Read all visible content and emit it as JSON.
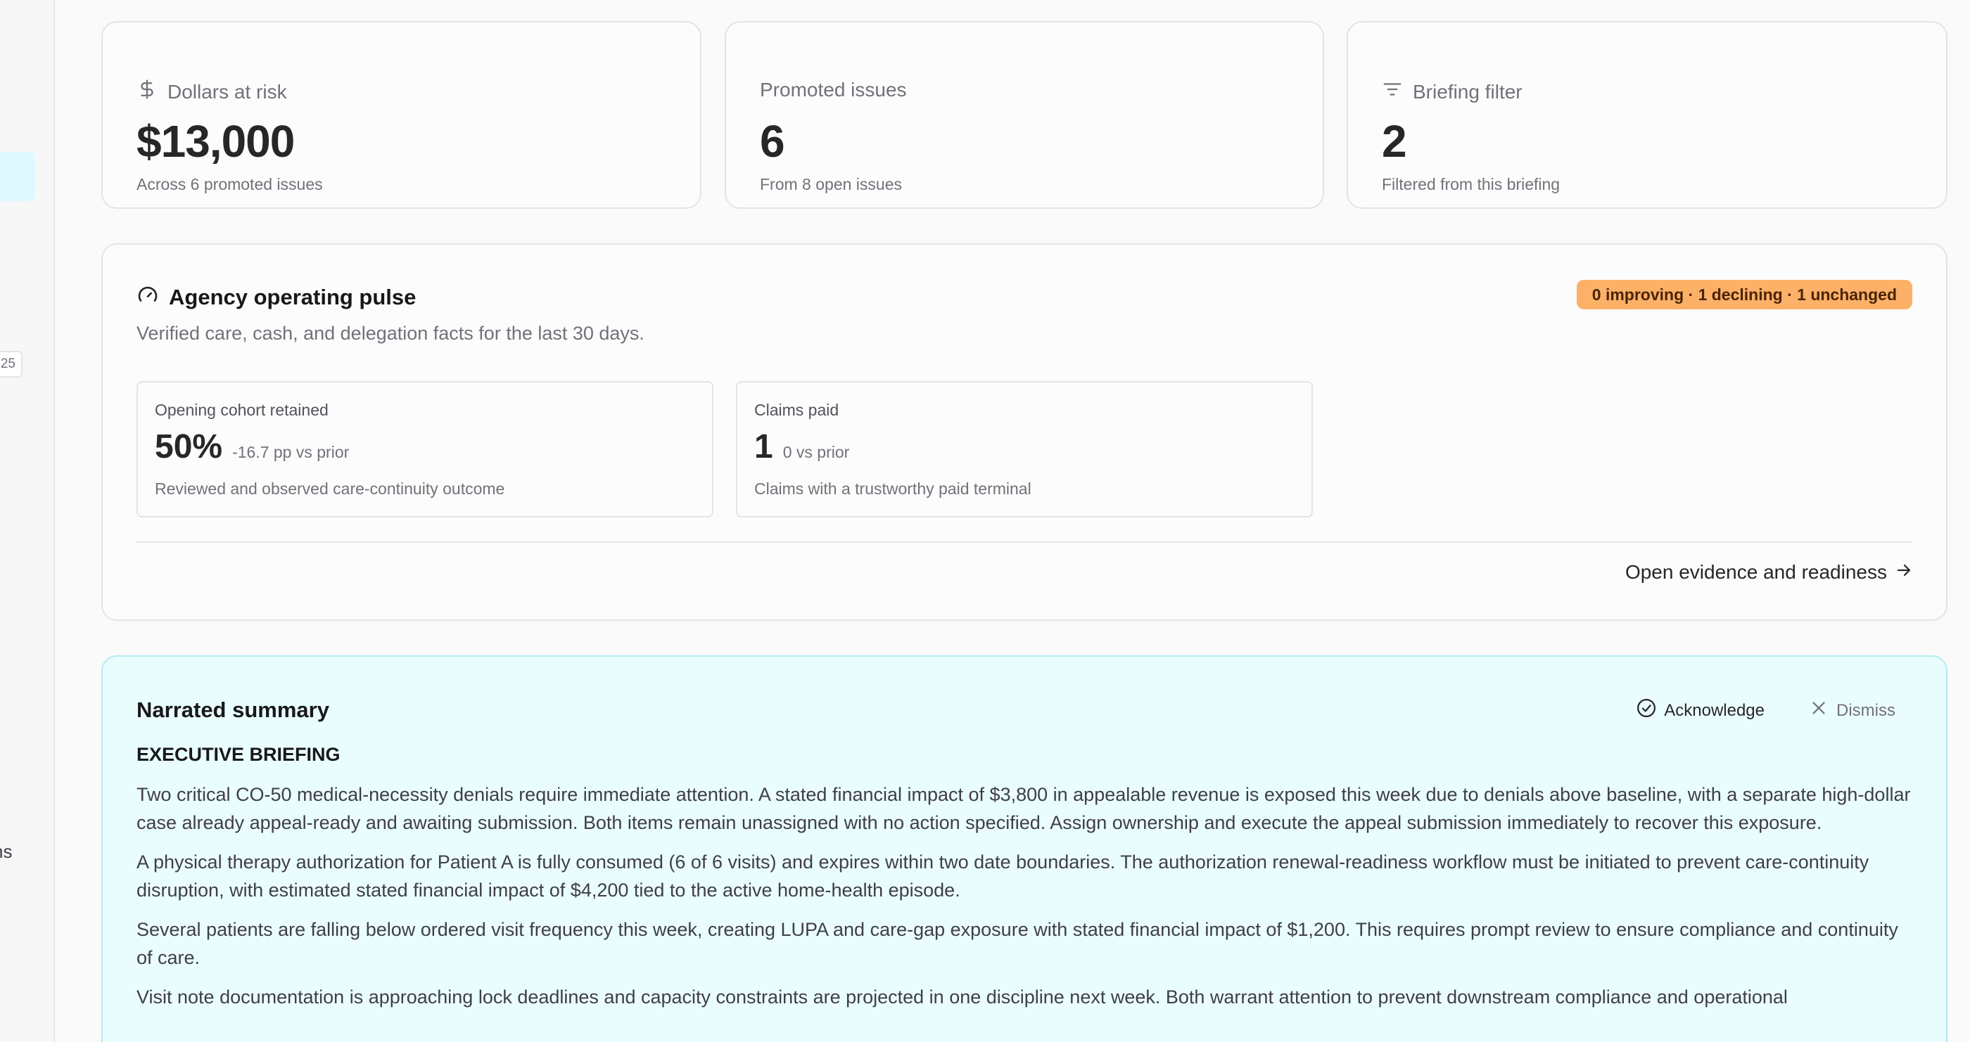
{
  "sidebar": {
    "badge_text": "25",
    "label_text": "ns"
  },
  "stats": [
    {
      "title": "Dollars at risk",
      "value": "$13,000",
      "sub": "Across 6 promoted issues",
      "icon": "dollar-icon"
    },
    {
      "title": "Promoted issues",
      "value": "6",
      "sub": "From 8 open issues",
      "icon": ""
    },
    {
      "title": "Briefing filter",
      "value": "2",
      "sub": "Filtered from this briefing",
      "icon": "filter-icon"
    }
  ],
  "pulse": {
    "title": "Agency operating pulse",
    "description": "Verified care, cash, and delegation facts for the last 30 days.",
    "trend_badge": "0 improving · 1 declining · 1 unchanged",
    "metrics": [
      {
        "label": "Opening cohort retained",
        "value": "50%",
        "delta": "-16.7 pp vs prior",
        "sub": "Reviewed and observed care-continuity outcome"
      },
      {
        "label": "Claims paid",
        "value": "1",
        "delta": "0 vs prior",
        "sub": "Claims with a trustworthy paid terminal"
      }
    ],
    "link_label": "Open evidence and readiness"
  },
  "summary": {
    "title": "Narrated summary",
    "acknowledge_label": "Acknowledge",
    "dismiss_label": "Dismiss",
    "heading": "EXECUTIVE BRIEFING",
    "paragraphs": [
      "Two critical CO-50 medical-necessity denials require immediate attention. A stated financial impact of $3,800 in appealable revenue is exposed this week due to denials above baseline, with a separate high-dollar case already appeal-ready and awaiting submission. Both items remain unassigned with no action specified. Assign ownership and execute the appeal submission immediately to recover this exposure.",
      "A physical therapy authorization for Patient A is fully consumed (6 of 6 visits) and expires within two date boundaries. The authorization renewal-readiness workflow must be initiated to prevent care-continuity disruption, with estimated stated financial impact of $4,200 tied to the active home-health episode.",
      "Several patients are falling below ordered visit frequency this week, creating LUPA and care-gap exposure with stated financial impact of $1,200. This requires prompt review to ensure compliance and continuity of care.",
      "Visit note documentation is approaching lock deadlines and capacity constraints are projected in one discipline next week. Both warrant attention to prevent downstream compliance and operational"
    ]
  },
  "colors": {
    "trend_badge_bg": "#fdb068",
    "summary_bg": "#eafdfe",
    "summary_border": "#b2ebf0",
    "sidebar_active_bg": "#dffaff"
  }
}
